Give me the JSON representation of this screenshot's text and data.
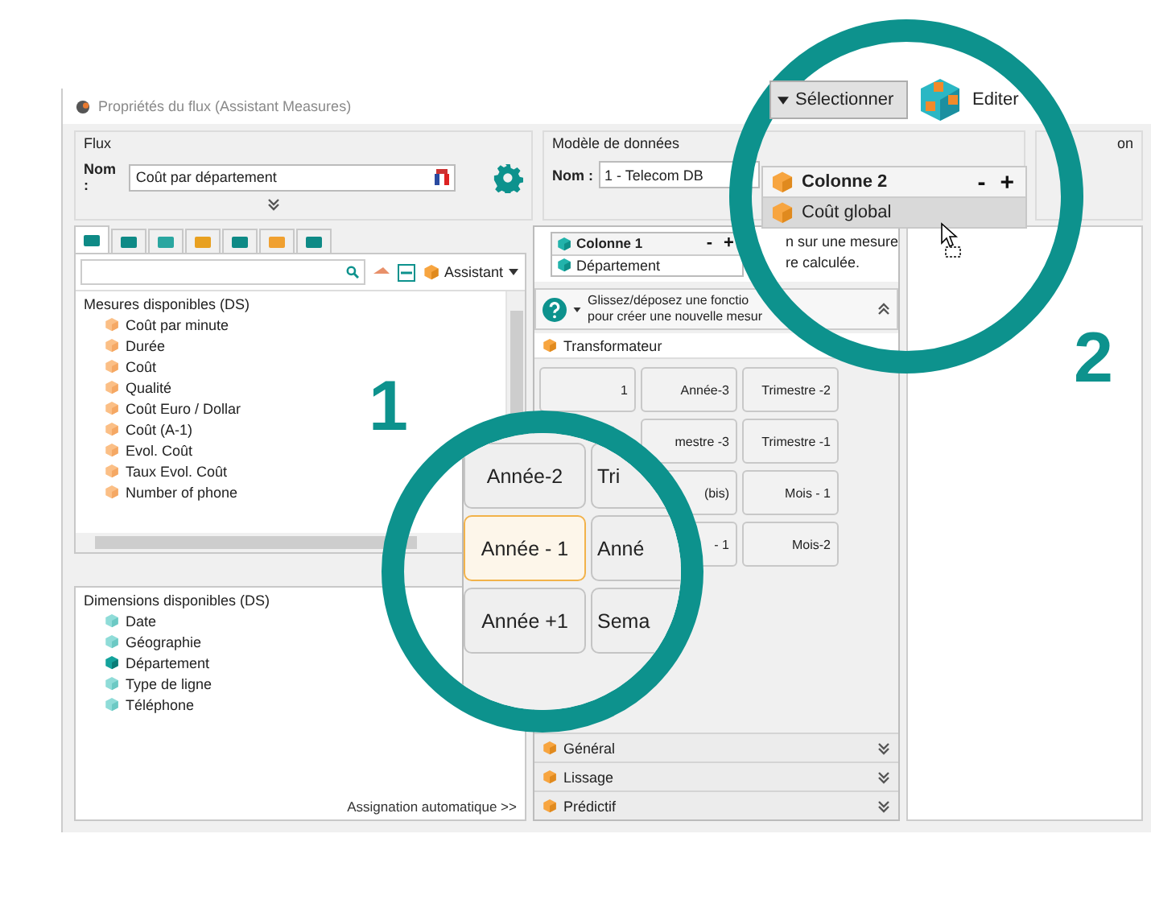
{
  "window": {
    "title": "Propriétés du flux (Assistant Measures)"
  },
  "flux_group": {
    "label": "Flux",
    "name_label": "Nom :",
    "name_value": "Coût par département"
  },
  "model_group": {
    "label": "Modèle de données",
    "name_label": "Nom :",
    "name_value": "1 - Telecom DB"
  },
  "group_3": {
    "label": "on"
  },
  "tabs": [
    {
      "selected": true
    },
    {
      "selected": false
    },
    {
      "selected": false
    },
    {
      "selected": false
    },
    {
      "selected": false
    },
    {
      "selected": false
    },
    {
      "selected": false
    }
  ],
  "assistant_button": "Assistant",
  "measures": {
    "title": "Mesures disponibles (DS)",
    "items": [
      "Coût par minute",
      "Durée",
      "Coût",
      "Qualité",
      "Coût Euro / Dollar",
      "Coût (A-1)",
      "Evol. Coût",
      "Taux Evol. Coût",
      "Number of phone"
    ]
  },
  "dimensions": {
    "title": "Dimensions disponibles (DS)",
    "items": [
      {
        "label": "Date",
        "used": false
      },
      {
        "label": "Géographie",
        "used": false
      },
      {
        "label": "Département",
        "used": true
      },
      {
        "label": "Type de ligne",
        "used": false
      },
      {
        "label": "Téléphone",
        "used": false
      }
    ]
  },
  "auto_assign_link": "Assignation automatique >>",
  "column_1": {
    "title": "Colonne 1",
    "minus": "-",
    "plus": "+",
    "items": [
      "Département"
    ]
  },
  "hint_fragment": [
    "n sur une mesure",
    "re calculée."
  ],
  "help": {
    "lines": [
      "Glissez/déposez une fonctio",
      "pour créer une nouvelle mesur"
    ]
  },
  "transformateur": {
    "title": "Transformateur",
    "rows": [
      [
        "1",
        "Année-3",
        "Trimestre -2"
      ],
      [
        null,
        "mestre -3",
        "Trimestre -1"
      ],
      [
        null,
        "(bis)",
        "Mois - 1"
      ],
      [
        null,
        "- 1",
        "Mois-2"
      ]
    ]
  },
  "sections": [
    {
      "title": "Général"
    },
    {
      "title": "Lissage"
    },
    {
      "title": "Prédictif"
    }
  ],
  "magnifier_1": {
    "label": "1",
    "buttons": [
      {
        "label": "Année-2",
        "selected": false
      },
      {
        "label": "Tri",
        "selected": false
      },
      {
        "label": "Année - 1",
        "selected": true
      },
      {
        "label": "Anné",
        "selected": false
      },
      {
        "label": "Année +1",
        "selected": false
      },
      {
        "label": "Sema",
        "selected": false
      }
    ]
  },
  "magnifier_2": {
    "label": "2",
    "select_button": "Sélectionner",
    "edit_button": "Editer",
    "column_2": {
      "title": "Colonne 2",
      "minus": "-",
      "plus": "+",
      "items": [
        {
          "label": "Coût global",
          "selected": true
        }
      ]
    }
  }
}
